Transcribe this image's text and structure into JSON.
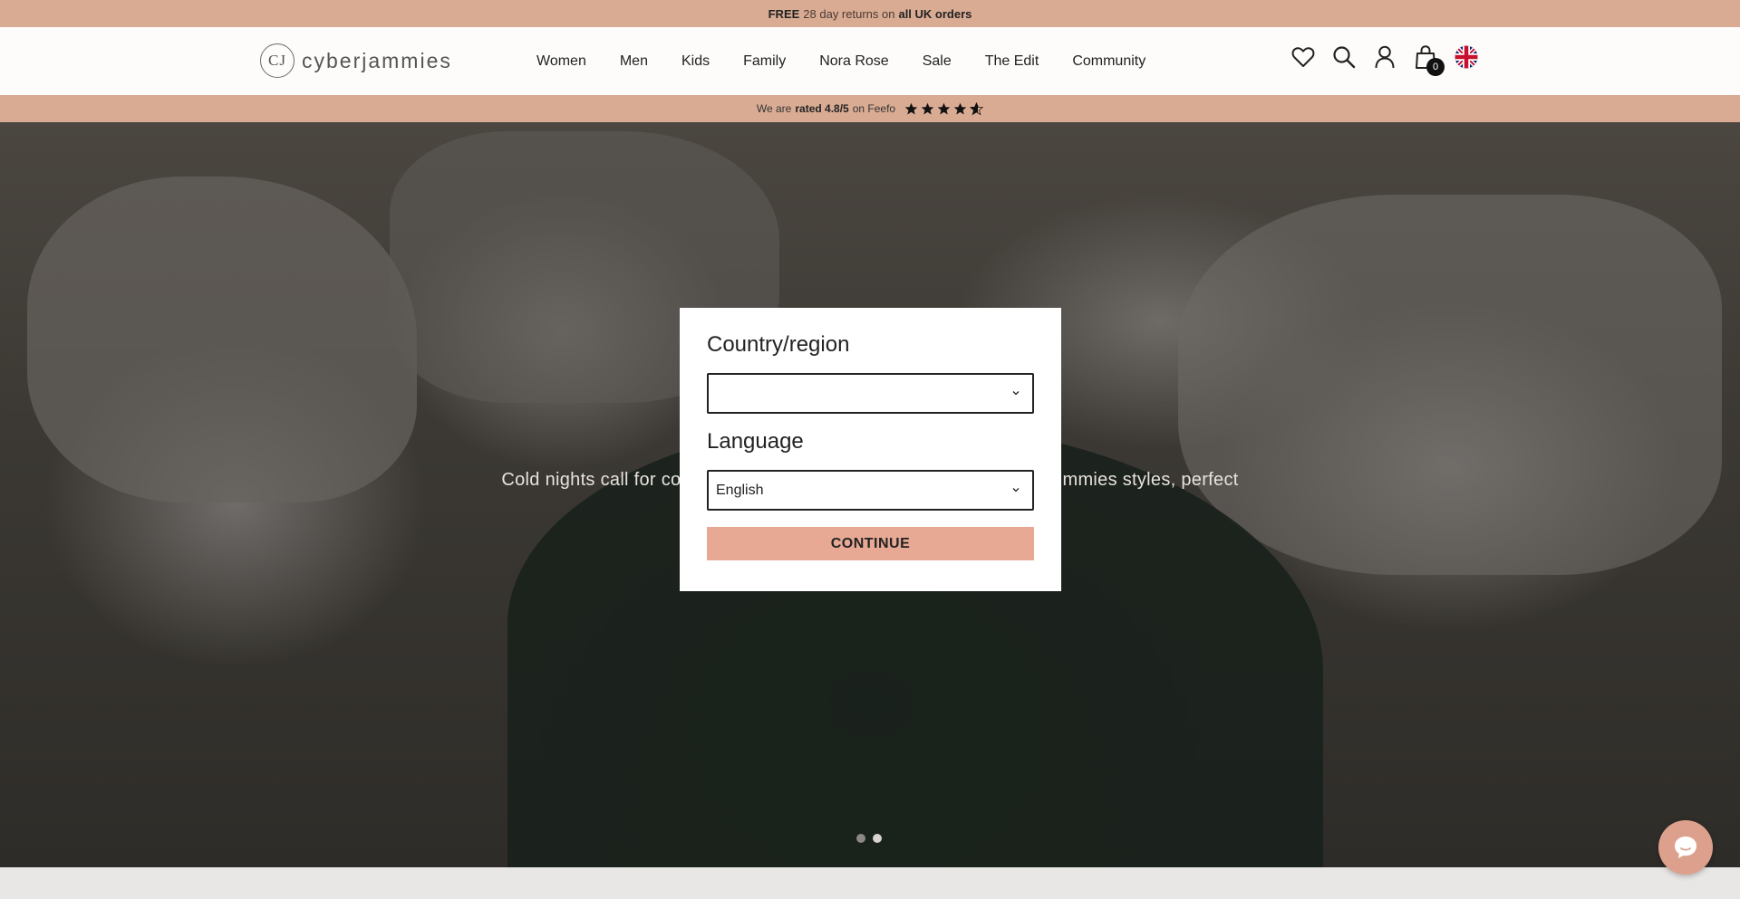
{
  "promo": {
    "bold1": "FREE",
    "text1": "28 day returns on",
    "bold2": "all UK orders"
  },
  "brand": {
    "mark": "CJ",
    "name": "cyberjammies"
  },
  "nav": {
    "items": [
      {
        "label": "Women"
      },
      {
        "label": "Men"
      },
      {
        "label": "Kids"
      },
      {
        "label": "Family"
      },
      {
        "label": "Nora Rose"
      },
      {
        "label": "Sale"
      },
      {
        "label": "The Edit"
      },
      {
        "label": "Community"
      }
    ]
  },
  "header_icons": {
    "wishlist": "heart-icon",
    "search": "search-icon",
    "account": "user-icon",
    "cart": "bag-icon",
    "cart_count": "0",
    "flag": "uk-flag-icon"
  },
  "rating": {
    "prefix": "We are",
    "rated": "rated 4.8/5",
    "suffix": "on Feefo",
    "stars": 4.8
  },
  "hero": {
    "caption_left": "Cold nights call for co",
    "caption_right": "mmies styles, perfect",
    "slides": 2,
    "active_slide": 2
  },
  "modal": {
    "country_label": "Country/region",
    "country_value": "",
    "language_label": "Language",
    "language_value": "English",
    "continue_label": "CONTINUE"
  },
  "chat": {
    "icon": "chat-bubble-icon"
  },
  "colors": {
    "accent": "#d9ab93",
    "button": "#e7a994"
  }
}
